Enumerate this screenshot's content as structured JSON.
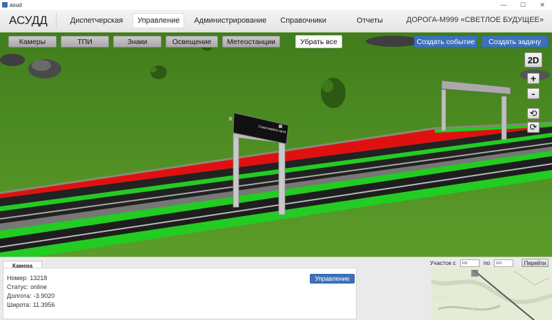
{
  "window": {
    "title": "asud",
    "minimize": "—",
    "maximize": "☐",
    "close": "✕"
  },
  "nav": {
    "brand": "АСУДД",
    "items": [
      "Диспетчерская",
      "Управление",
      "Администрирование",
      "Справочники",
      "Отчеты"
    ],
    "active": "Управление",
    "road": "ДОРОГА-М999  «СВЕТЛОЕ БУДУЩЕЕ»"
  },
  "toolbar": {
    "layers": [
      "Камеры",
      "ТПИ",
      "Знаки",
      "Освещение",
      "Метеостанции"
    ],
    "clear": "Убрать все",
    "create_event": "Создать событие",
    "create_task": "Создать задачу"
  },
  "controls": {
    "view2d": "2D",
    "zoom_in": "+",
    "zoom_out": "-",
    "rotate_left": "⟲",
    "rotate_right": "⟳"
  },
  "sign_text": "Счастливого пути",
  "camera": {
    "tab": "Камера",
    "number_label": "Номер:",
    "number": "13218",
    "status_label": "Статус:",
    "status": "online",
    "lon_label": "Долгота:",
    "lon": "-3.9020",
    "lat_label": "Широта:",
    "lat": "11.3956",
    "manage": "Управление"
  },
  "segment": {
    "label_from": "Участок с",
    "placeholder_from": "км",
    "label_to": "по",
    "placeholder_to": "км",
    "go": "Перейти"
  },
  "colors": {
    "accent": "#3d72b8",
    "grass": "#4f8f22",
    "road_green": "#22cc22",
    "road_red": "#e01010"
  }
}
